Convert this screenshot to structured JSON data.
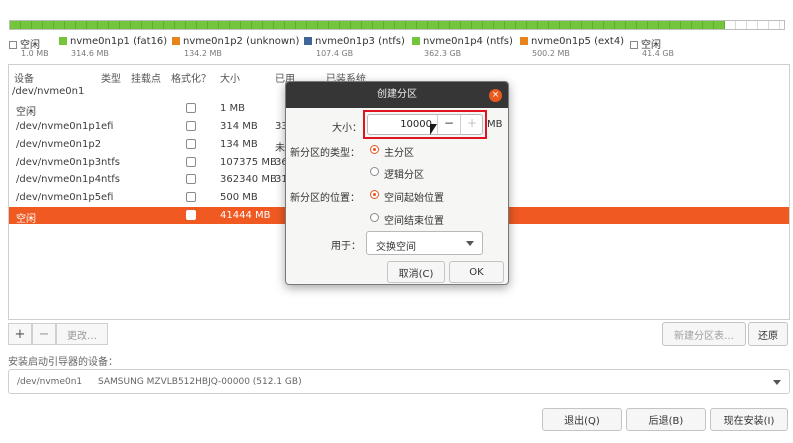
{
  "partition_bar": [
    {
      "name": "free-start",
      "fraction": 0.0
    },
    {
      "name": "nvme0n1p1",
      "fraction": 0.0006
    },
    {
      "name": "nvme0n1p2",
      "fraction": 0.0003
    },
    {
      "name": "nvme0n1p3",
      "fraction": 0.21
    },
    {
      "name": "nvme0n1p4",
      "fraction": 0.709
    },
    {
      "name": "nvme0n1p5",
      "fraction": 0.001
    },
    {
      "name": "free-end",
      "fraction": 0.081
    }
  ],
  "legend": [
    {
      "name": "空闲",
      "size": "1.0 MB",
      "color": "#ffffff"
    },
    {
      "name": "nvme0n1p1 (fat16)",
      "size": "314.6 MB",
      "color": "#73c63c"
    },
    {
      "name": "nvme0n1p2 (unknown)",
      "size": "134.2 MB",
      "color": "#e8841c"
    },
    {
      "name": "nvme0n1p3 (ntfs)",
      "size": "107.4 GB",
      "color": "#3f6698"
    },
    {
      "name": "nvme0n1p4 (ntfs)",
      "size": "362.3 GB",
      "color": "#73c63c"
    },
    {
      "name": "nvme0n1p5 (ext4)",
      "size": "500.2 MB",
      "color": "#e8841c"
    },
    {
      "name": "空闲",
      "size": "41.4 GB",
      "color": "#ffffff"
    }
  ],
  "table": {
    "headers": [
      "设备",
      "类型",
      "挂载点",
      "格式化？",
      "大小",
      "已用",
      "已装系统"
    ],
    "rows": [
      {
        "device": "/dev/nvme0n1",
        "type": "",
        "size": "",
        "used": "",
        "checkbox": false
      },
      {
        "device": "空闲",
        "type": "",
        "size": "1 MB",
        "used": "",
        "checkbox": true
      },
      {
        "device": "/dev/nvme0n1p1",
        "type": "efi",
        "size": "314 MB",
        "used": "33",
        "checkbox": true
      },
      {
        "device": "/dev/nvme0n1p2",
        "type": "",
        "size": "134 MB",
        "used": "未",
        "checkbox": true
      },
      {
        "device": "/dev/nvme0n1p3",
        "type": "ntfs",
        "size": "107375 MB",
        "used": "36",
        "checkbox": true
      },
      {
        "device": "/dev/nvme0n1p4",
        "type": "ntfs",
        "size": "362340 MB",
        "used": "31",
        "checkbox": true
      },
      {
        "device": "/dev/nvme0n1p5",
        "type": "efi",
        "size": "500 MB",
        "used": "",
        "checkbox": true
      },
      {
        "device": "空闲",
        "type": "",
        "size": "41444 MB",
        "used": "",
        "checkbox": true,
        "selected": true
      }
    ]
  },
  "toolbar": {
    "add": "+",
    "remove": "−",
    "change": "更改…",
    "new_table": "新建分区表…",
    "revert": "还原"
  },
  "boot": {
    "label": "安装启动引导器的设备：",
    "device": "/dev/nvme0n1",
    "model": "SAMSUNG MZVLB512HBJQ-00000 (512.1 GB)"
  },
  "footer": {
    "quit": "退出(Q)",
    "back": "后退(B)",
    "install": "现在安装(I)"
  },
  "dialog": {
    "title": "创建分区",
    "close": "×",
    "size_label": "大小：",
    "size_value": "10000",
    "size_unit": "MB",
    "minus": "−",
    "plus": "+",
    "type_label": "新分区的类型：",
    "type_primary": "主分区",
    "type_logical": "逻辑分区",
    "location_label": "新分区的位置：",
    "location_start": "空间起始位置",
    "location_end": "空间结束位置",
    "use_label": "用于：",
    "use_value": "交换空间",
    "cancel": "取消(C)",
    "ok": "OK"
  },
  "colors": {
    "accent": "#e95420",
    "selected_row": "#f05a22",
    "title_bar": "#363636",
    "highlight": "#e0141e"
  }
}
